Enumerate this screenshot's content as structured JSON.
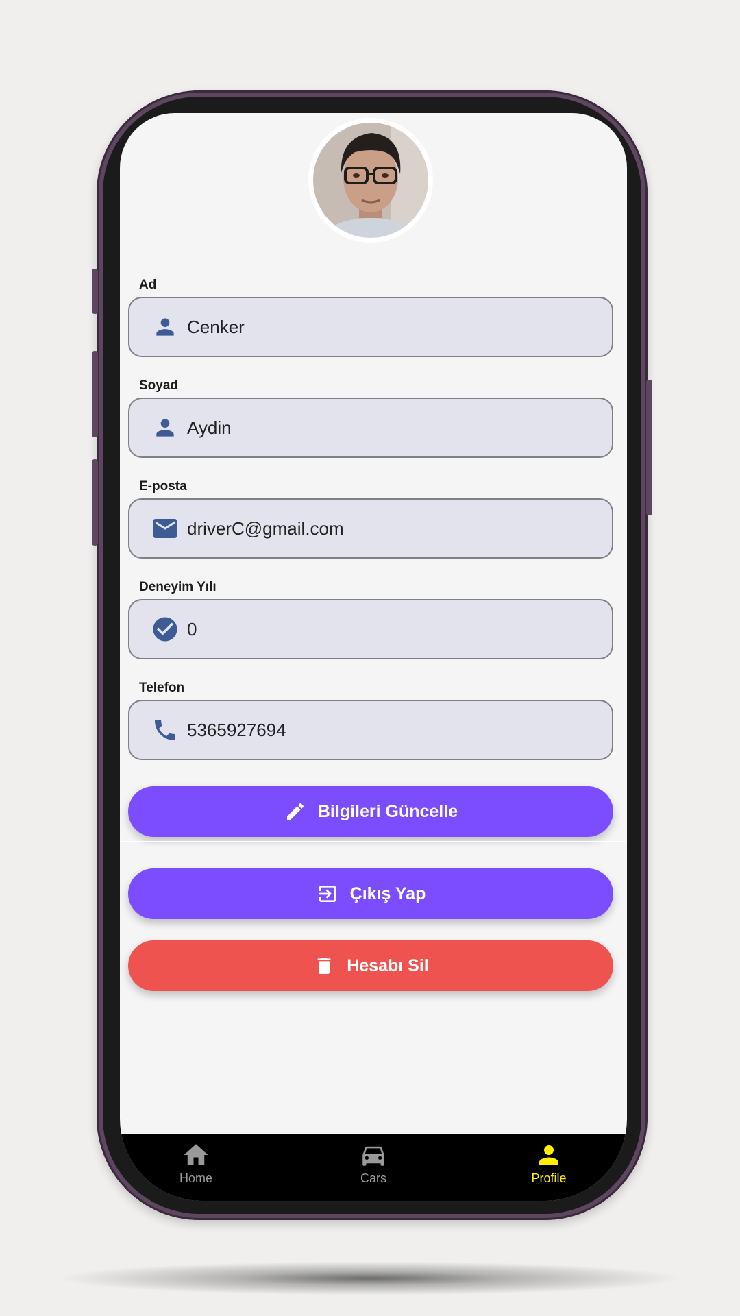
{
  "profile": {
    "fields": [
      {
        "label": "Ad",
        "value": "Cenker",
        "icon": "person-icon"
      },
      {
        "label": "Soyad",
        "value": "Aydin",
        "icon": "person-icon"
      },
      {
        "label": "E-posta",
        "value": "driverC@gmail.com",
        "icon": "mail-icon"
      },
      {
        "label": "Deneyim Yılı",
        "value": "0",
        "icon": "check-circle-icon"
      },
      {
        "label": "Telefon",
        "value": "5365927694",
        "icon": "phone-icon"
      }
    ],
    "update_label": "Bilgileri Güncelle",
    "logout_label": "Çıkış Yap",
    "delete_label": "Hesabı Sil"
  },
  "nav": {
    "items": [
      {
        "label": "Home",
        "icon": "home-icon",
        "active": false
      },
      {
        "label": "Cars",
        "icon": "car-icon",
        "active": false
      },
      {
        "label": "Profile",
        "icon": "person-icon",
        "active": true
      }
    ]
  },
  "colors": {
    "primary": "#7c4dff",
    "danger": "#ef5350",
    "field_bg": "#e3e3ee",
    "icon_blue": "#3f5b96",
    "nav_active": "#ffee00",
    "nav_inactive": "#9a9a9a"
  }
}
